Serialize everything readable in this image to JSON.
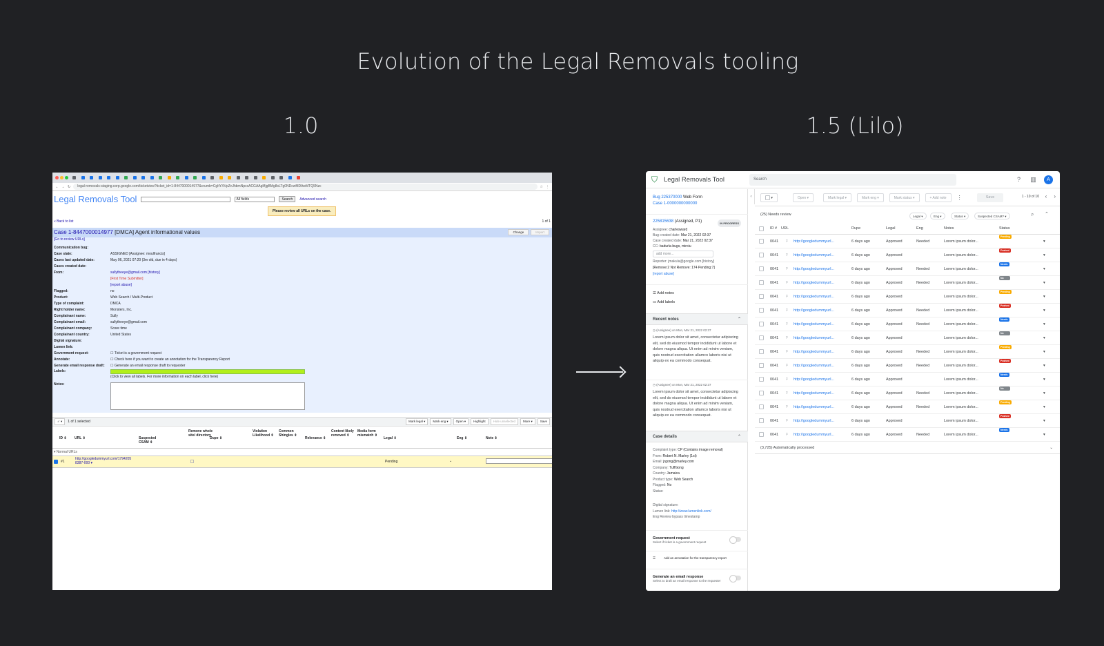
{
  "slide": {
    "title": "Evolution of the Legal Removals tooling",
    "left_version": "1.0",
    "right_version": "1.5 (Lilo)"
  },
  "old": {
    "url": "legal-removals-staging.corp.google.com/ticketview?ticket_id=1-8447000014977&crumb=CgItYXVpZnJhbmNpcxACGAAgMjgBMg8xLTg0NDcwMDAwMTQ5Nzc",
    "logo": "Legal Removals Tool",
    "search_scope": "All fields",
    "search_btn": "Search",
    "advanced": "Advanced search",
    "warning": "Please review all URLs on the case.",
    "back": "« Back to list",
    "pager": "1 of 1",
    "case_number": "Case 1-8447000014977",
    "case_title": " [DMCA] Agent informational values",
    "change_btn": "Change",
    "import_btn": "Import",
    "go_review": "[Go to review URLs]",
    "fields": [
      {
        "k": "Communication bug:",
        "v": ""
      },
      {
        "k": "Case state:",
        "v": "ASSIGNED [Assignee: moulfrancis]"
      },
      {
        "k": "Cases last updated date:",
        "v": "May 06, 2021 07:20 (3m old, due in 4 days)"
      },
      {
        "k": "Cases created date:",
        "v": ""
      },
      {
        "k": "From:",
        "v": "sullytheeye@gmail.com [history]"
      },
      {
        "k": "",
        "v": "[First Time Submitter]"
      },
      {
        "k": "",
        "v": "[report abuse]"
      },
      {
        "k": "Flagged:",
        "v": "no"
      },
      {
        "k": "Product:",
        "v": "Web Search / Multi-Product"
      },
      {
        "k": "Type of complaint:",
        "v": "DMCA"
      },
      {
        "k": "Right holder name:",
        "v": "Monsters, Inc."
      },
      {
        "k": "Complainant name:",
        "v": "Sully"
      },
      {
        "k": "Complainant email:",
        "v": "sullytheeye@gmail.com"
      },
      {
        "k": "Complainant company:",
        "v": "Scare time"
      },
      {
        "k": "Complainant country:",
        "v": "United States"
      },
      {
        "k": "Digital signature:",
        "v": ""
      },
      {
        "k": "Lumen link:",
        "v": ""
      },
      {
        "k": "Government request:",
        "v": "☐ Ticket is a government request"
      },
      {
        "k": "Annotate:",
        "v": "☐ Check here if you want to create an annotation for the Transparency Report"
      },
      {
        "k": "Generate email response draft:",
        "v": "☐ Generate an email response draft to requester"
      }
    ],
    "labels_label": "Labels:",
    "labels_hint": "(Click to view all labels. For more information on each label, click here)",
    "notes_label": "Notes:",
    "selected": "1 of 1 selected",
    "toolbar": [
      "Mark legal ▾",
      "Mark eng ▾",
      "Open ▾",
      "Highlight",
      "Hide unselected",
      "More ▾",
      "Save"
    ],
    "columns": [
      "ID ⇕",
      "URL ⇕",
      "Suspected CSAM ⇕",
      "Remove whole site/ directory",
      "Dupe ⇕",
      "Violation Likelihood ⇕",
      "Common Shingles ⇕",
      "Relevance ⇕",
      "Content likely removed ⇕",
      "Media form mismatch ⇕",
      "Legal ⇕",
      "Eng ⇕",
      "Note ⇕"
    ],
    "normal_urls": "▾ Normal URLs",
    "row": {
      "id": "#1",
      "url": "http://googledummyurl.com/1794205 8387-000 ▾",
      "legal": "Pending"
    }
  },
  "new": {
    "title": "Legal Removals Tool",
    "search_placeholder": "Search",
    "avatar": "A",
    "bug": "Bug 225370000",
    "bug_suffix": " Web Form",
    "case": "Case 1-0000000000000",
    "ticket": "225815638",
    "ticket_suffix": " (Assigned, P1)",
    "status_pill": "IN PROGRESS",
    "meta": [
      {
        "k": "Assignee:",
        "v": "charlesward"
      },
      {
        "k": "Bug created date:",
        "v": "Mar 21, 2022 02:37"
      },
      {
        "k": "Case created date:",
        "v": "Mar 21, 2022 02:37"
      },
      {
        "k": "CC:",
        "v": "badurla-bugs, miroiu"
      }
    ],
    "add_more": "add more...",
    "reporter": "Reporter: jmakula@google.com [history]",
    "remove_counts": "[Remove:2 Not Remove: 174 Pending:7]",
    "report_abuse": "[report abuse]",
    "add_notes": "Add notes",
    "add_labels": "Add labels",
    "recent_notes": "Recent notes",
    "note_meta_1": "(Assignee) on Mon, Mar 21, 2022 02:37",
    "note_meta_2": "(Assignee) on Mon, Mar 21, 2022 02:37",
    "note_text": "Lorem ipsum dolor sit amet, consectetur adipiscing elit, sed do eiusmod tempor incididunt ut labore et dolore magna aliqua. Ut enim ad minim veniam, quis nostrud exercitation ullamco laboris nisi ut aliquip ex ea commodo consequat.",
    "case_details": "Case details",
    "details": [
      {
        "k": "Complaint type:",
        "v": "CP (Contains image removal)"
      },
      {
        "k": "From:",
        "v": "Robert N. Marley (1st)"
      },
      {
        "k": "Email:",
        "v": "jrgong@marley.com"
      },
      {
        "k": "Company:",
        "v": "TuffGong"
      },
      {
        "k": "Country:",
        "v": "Jamaica"
      },
      {
        "k": "Product type:",
        "v": "Web Search"
      },
      {
        "k": "Flagged:",
        "v": "No"
      },
      {
        "k": "Status:",
        "v": ""
      }
    ],
    "digital_signature": "Digital signature:",
    "lumen_label": "Lumen link:",
    "lumen_url": "http://www.lumenlink.com/",
    "eng_review": "Eng Review bypass timestamp",
    "gov_title": "Government request",
    "gov_sub": "Select if ticket is a government request",
    "annot": "Add an annotation for the transparency report",
    "email_title": "Generate an email response",
    "email_sub": "Select to draft an email response to the requester",
    "toolbar": {
      "open": "Open ▾",
      "mark_legal": "Mark legal ▾",
      "mark_eng": "Mark eng ▾",
      "mark_status": "Mark status ▾",
      "add_note": "+ Add note",
      "save": "Save",
      "page": "1 - 10 of 10"
    },
    "needs_review": "(25) Needs review",
    "filters": [
      "Legal ▾",
      "Eng ▾",
      "Status ▾",
      "Suspected CSAM? ▾"
    ],
    "columns": [
      "ID #",
      "URL",
      "Dupe",
      "Legal",
      "Eng",
      "Notes",
      "Status"
    ],
    "rows": [
      {
        "id": "0041",
        "url": "http://googledummyurl...",
        "dupe": "6 days ago",
        "legal": "Approved",
        "eng": "Needed",
        "notes": "Lorem ipsum dolor...",
        "status": "Pending removal",
        "color": "#f9ab00"
      },
      {
        "id": "0041",
        "url": "http://googledummyurl...",
        "dupe": "6 days ago",
        "legal": "Approved",
        "eng": "",
        "notes": "Lorem ipsum dolor...",
        "status": "Pushed back",
        "color": "#d93025"
      },
      {
        "id": "0041",
        "url": "http://googledummyurl...",
        "dupe": "6 days ago",
        "legal": "Approved",
        "eng": "Needed",
        "notes": "Lorem ipsum dolor...",
        "status": "Needs review",
        "color": "#1a73e8"
      },
      {
        "id": "0041",
        "url": "http://googledummyurl...",
        "dupe": "6 days ago",
        "legal": "Approved",
        "eng": "Needed",
        "notes": "Lorem ipsum dolor...",
        "status": "No review needed",
        "color": "#80868b"
      },
      {
        "id": "0041",
        "url": "http://googledummyurl...",
        "dupe": "6 days ago",
        "legal": "Approved",
        "eng": "",
        "notes": "Lorem ipsum dolor...",
        "status": "Pending removal",
        "color": "#f9ab00"
      },
      {
        "id": "0041",
        "url": "http://googledummyurl...",
        "dupe": "6 days ago",
        "legal": "Approved",
        "eng": "Needed",
        "notes": "Lorem ipsum dolor...",
        "status": "Pushed back",
        "color": "#d93025"
      },
      {
        "id": "0041",
        "url": "http://googledummyurl...",
        "dupe": "6 days ago",
        "legal": "Approved",
        "eng": "Needed",
        "notes": "Lorem ipsum dolor...",
        "status": "Needs review",
        "color": "#1a73e8"
      },
      {
        "id": "0041",
        "url": "http://googledummyurl...",
        "dupe": "6 days ago",
        "legal": "Approved",
        "eng": "",
        "notes": "Lorem ipsum dolor...",
        "status": "No review needed",
        "color": "#80868b"
      },
      {
        "id": "0041",
        "url": "http://googledummyurl...",
        "dupe": "6 days ago",
        "legal": "Approved",
        "eng": "Needed",
        "notes": "Lorem ipsum dolor...",
        "status": "Pending removal",
        "color": "#f9ab00"
      },
      {
        "id": "0041",
        "url": "http://googledummyurl...",
        "dupe": "6 days ago",
        "legal": "Approved",
        "eng": "Needed",
        "notes": "Lorem ipsum dolor...",
        "status": "Pushed back",
        "color": "#d93025"
      },
      {
        "id": "0041",
        "url": "http://googledummyurl...",
        "dupe": "6 days ago",
        "legal": "Approved",
        "eng": "",
        "notes": "Lorem ipsum dolor...",
        "status": "Needs review",
        "color": "#1a73e8"
      },
      {
        "id": "0041",
        "url": "http://googledummyurl...",
        "dupe": "6 days ago",
        "legal": "Approved",
        "eng": "Needed",
        "notes": "Lorem ipsum dolor...",
        "status": "No review needed",
        "color": "#80868b"
      },
      {
        "id": "0041",
        "url": "http://googledummyurl...",
        "dupe": "6 days ago",
        "legal": "Approved",
        "eng": "Needed",
        "notes": "Lorem ipsum dolor...",
        "status": "Pending removal",
        "color": "#f9ab00"
      },
      {
        "id": "0041",
        "url": "http://googledummyurl...",
        "dupe": "6 days ago",
        "legal": "Approved",
        "eng": "",
        "notes": "Lorem ipsum dolor...",
        "status": "Pushed back",
        "color": "#d93025"
      },
      {
        "id": "0041",
        "url": "http://googledummyurl...",
        "dupe": "6 days ago",
        "legal": "Approved",
        "eng": "Needed",
        "notes": "Lorem ipsum dolor...",
        "status": "Needs review",
        "color": "#1a73e8"
      }
    ],
    "auto_processed": "(3,725) Automatically processed"
  }
}
